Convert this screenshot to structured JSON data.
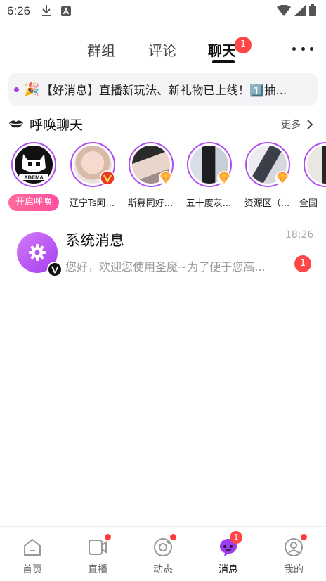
{
  "status_bar": {
    "time": "6:26"
  },
  "tabs": [
    {
      "label": "群组"
    },
    {
      "label": "评论"
    },
    {
      "label": "聊天",
      "badge": "1"
    }
  ],
  "notice": {
    "text": "【好消息】直播新玩法、新礼物已上线！1️⃣抽..."
  },
  "call_section": {
    "title": "呼唤聊天",
    "more": "更多",
    "call_button": "开启呼唤",
    "users": [
      {
        "name": "辽宁Ts阿..."
      },
      {
        "name": "斯慕同好..."
      },
      {
        "name": "五十度灰..."
      },
      {
        "name": "资源区（..."
      },
      {
        "name": "全国"
      }
    ]
  },
  "messages": [
    {
      "title": "系统消息",
      "time": "18:26",
      "preview": "您好，欢迎您使用圣魔~为了便于您高...",
      "unread": "1"
    }
  ],
  "bottom_nav": [
    {
      "label": "首页"
    },
    {
      "label": "直播"
    },
    {
      "label": "动态"
    },
    {
      "label": "消息",
      "badge": "1"
    },
    {
      "label": "我的"
    }
  ],
  "colors": {
    "accent": "#b04ef0",
    "badge": "#ff4747",
    "call_button": "#ff5c9c"
  }
}
